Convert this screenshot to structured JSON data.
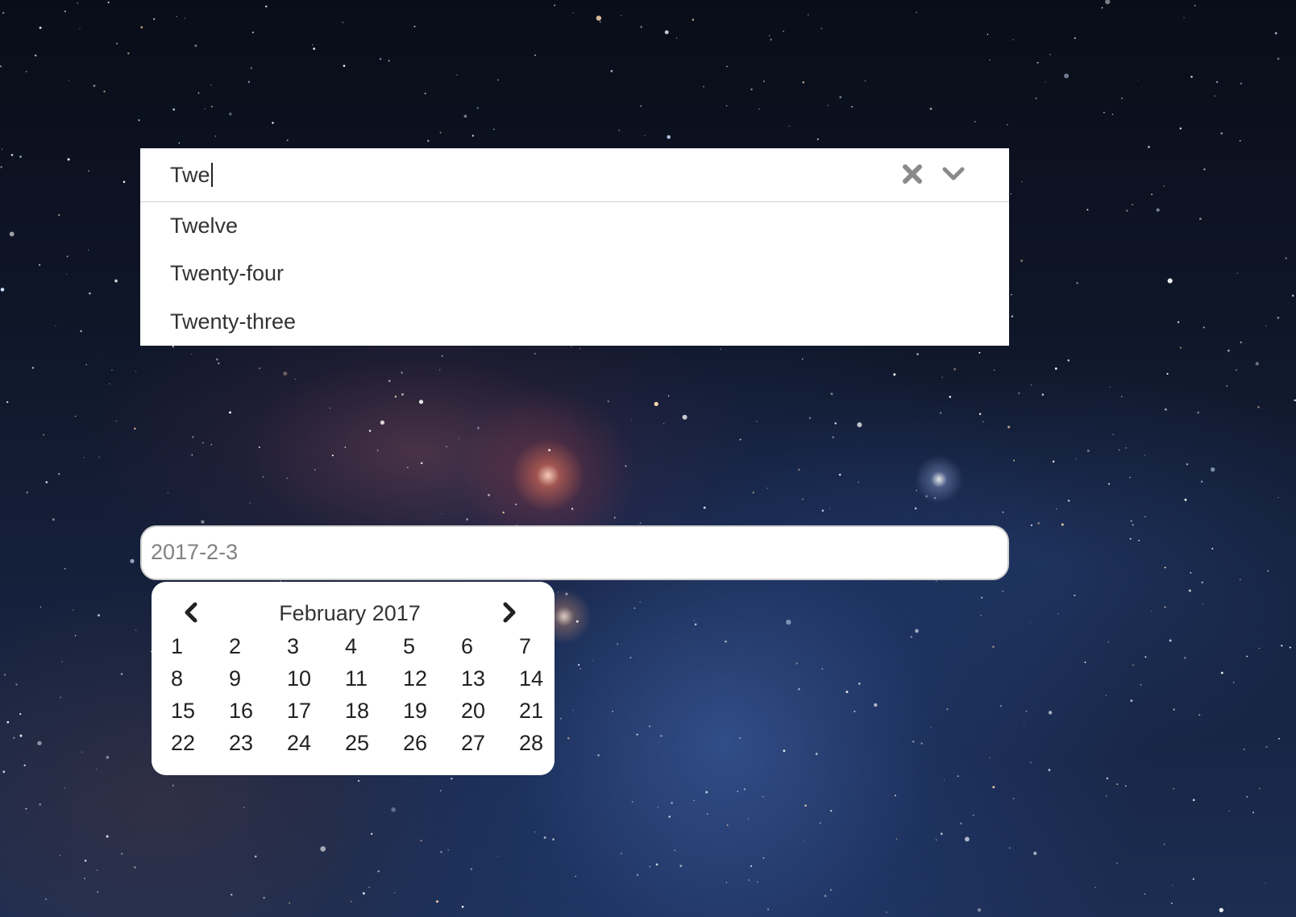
{
  "combobox": {
    "input_value": "Twe",
    "clear_icon": "close-icon",
    "toggle_icon": "chevron-down-icon",
    "options": [
      "Twelve",
      "Twenty-four",
      "Twenty-three"
    ]
  },
  "date_input": {
    "value": "2017-2-3"
  },
  "calendar": {
    "title": "February 2017",
    "prev_icon": "chevron-left-icon",
    "next_icon": "chevron-right-icon",
    "weeks": [
      [
        "1",
        "2",
        "3",
        "4",
        "5",
        "6",
        "7"
      ],
      [
        "8",
        "9",
        "10",
        "11",
        "12",
        "13",
        "14"
      ],
      [
        "15",
        "16",
        "17",
        "18",
        "19",
        "20",
        "21"
      ],
      [
        "22",
        "23",
        "24",
        "25",
        "26",
        "27",
        "28"
      ]
    ]
  },
  "colors": {
    "panel_bg": "#ffffff",
    "text": "#333333",
    "placeholder_text": "#808080",
    "icon_gray": "#8a8a8a",
    "border": "#cfcfcf"
  }
}
